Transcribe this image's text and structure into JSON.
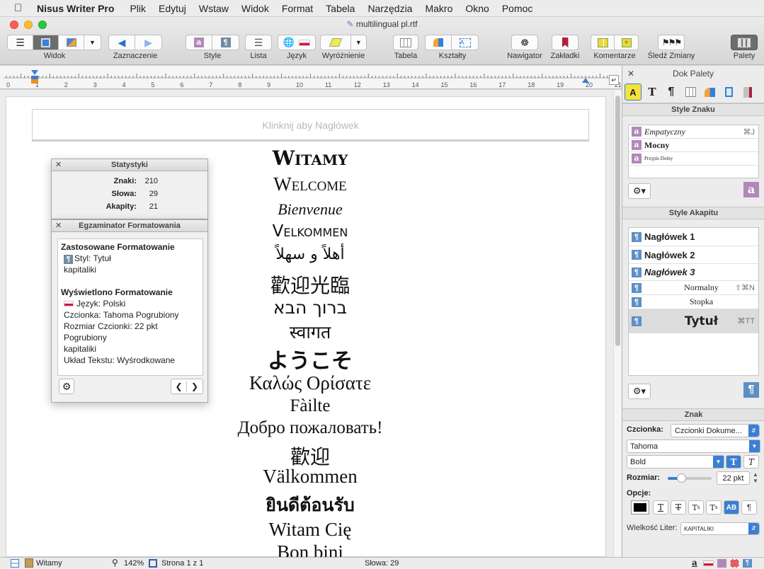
{
  "menubar": {
    "apple": "",
    "app": "Nisus Writer Pro",
    "items": [
      "Plik",
      "Edytuj",
      "Wstaw",
      "Widok",
      "Format",
      "Tabela",
      "Narzędzia",
      "Makro",
      "Okno",
      "Pomoc"
    ]
  },
  "window": {
    "title": "multilingual pl.rtf"
  },
  "toolbar": {
    "labels": {
      "widok": "Widok",
      "zaznaczenie": "Zaznaczenie",
      "style": "Style",
      "lista": "Lista",
      "jezyk": "Język",
      "wyroznienie": "Wyróżnienie",
      "tabela": "Tabela",
      "ksztalty": "Kształty",
      "nawigator": "Nawigator",
      "zakladki": "Zakładki",
      "komentarze": "Komentarze",
      "sledz": "Śledź Zmiany",
      "palety": "Palety"
    }
  },
  "ruler": {
    "numbers": [
      "0",
      "1",
      "2",
      "3",
      "4",
      "5",
      "6",
      "7",
      "8",
      "9",
      "10",
      "11",
      "12",
      "13",
      "14",
      "15",
      "16",
      "17",
      "18",
      "19",
      "20",
      "21"
    ]
  },
  "header_placeholder": "Klinknij aby Nagłówek",
  "greetings": [
    "Witamy",
    "Welcome",
    "Bienvenue",
    "Velkommen",
    "أهلاً و سهلاً",
    "歡迎光臨",
    "ברוך הבא",
    "स्वागत",
    "ようこそ",
    "Καλώς Ορίσατε",
    "Fàilte",
    "Добро пожаловать!",
    "歡迎",
    "Välkommen",
    "ยินดีต้อนรับ",
    "Witam Cię",
    "Bon bini"
  ],
  "stats": {
    "title": "Statystyki",
    "rows": [
      {
        "label": "Znaki:",
        "value": "210"
      },
      {
        "label": "Słowa:",
        "value": "29"
      },
      {
        "label": "Akapity:",
        "value": "21"
      }
    ]
  },
  "inspector": {
    "title": "Egzaminator Formatowania",
    "applied_heading": "Zastosowane Formatowanie",
    "style_line": "Styl: Tytuł",
    "caps": "kapitaliki",
    "shown_heading": "Wyświetlono Formatowanie",
    "lang": "Język: Polski",
    "font": "Czcionka: Tahoma Pogrubiony",
    "size": "Rozmiar Czcionki: 22 pkt",
    "size2": "Pogrubiony",
    "caps2": "kapitaliki",
    "layout": "Układ Tekstu: Wyśrodkowane"
  },
  "palette": {
    "title": "Dok Palety",
    "char_styles_title": "Style Znaku",
    "char_styles": [
      {
        "name": "Empatyczny",
        "shortcut": "⌘J"
      },
      {
        "name": "Mocny",
        "shortcut": ""
      },
      {
        "name": "Przypis Dolny",
        "shortcut": ""
      }
    ],
    "para_styles_title": "Style Akapitu",
    "para_styles": [
      {
        "name": "Nagłówek 1",
        "shortcut": ""
      },
      {
        "name": "Nagłówek 2",
        "shortcut": ""
      },
      {
        "name": "Nagłówek 3",
        "shortcut": ""
      },
      {
        "name": "Normalny",
        "shortcut": "⇧⌘N"
      },
      {
        "name": "Stopka",
        "shortcut": ""
      },
      {
        "name": "Tytuł",
        "shortcut": "⌘TT"
      }
    ],
    "znak_title": "Znak",
    "font_label": "Czcionka:",
    "font_menu": "Czcionki Dokume...",
    "font_name": "Tahoma",
    "font_style": "Bold",
    "size_label": "Rozmiar:",
    "size_value": "22 pkt",
    "size_level": 0.3,
    "options_label": "Opcje:",
    "case_label": "Wielkość Liter:",
    "case_value": "kapitaliki"
  },
  "status": {
    "style": "Witamy",
    "zoom": "142%",
    "page": "Strona 1 z 1",
    "words": "Słowa: 29"
  }
}
